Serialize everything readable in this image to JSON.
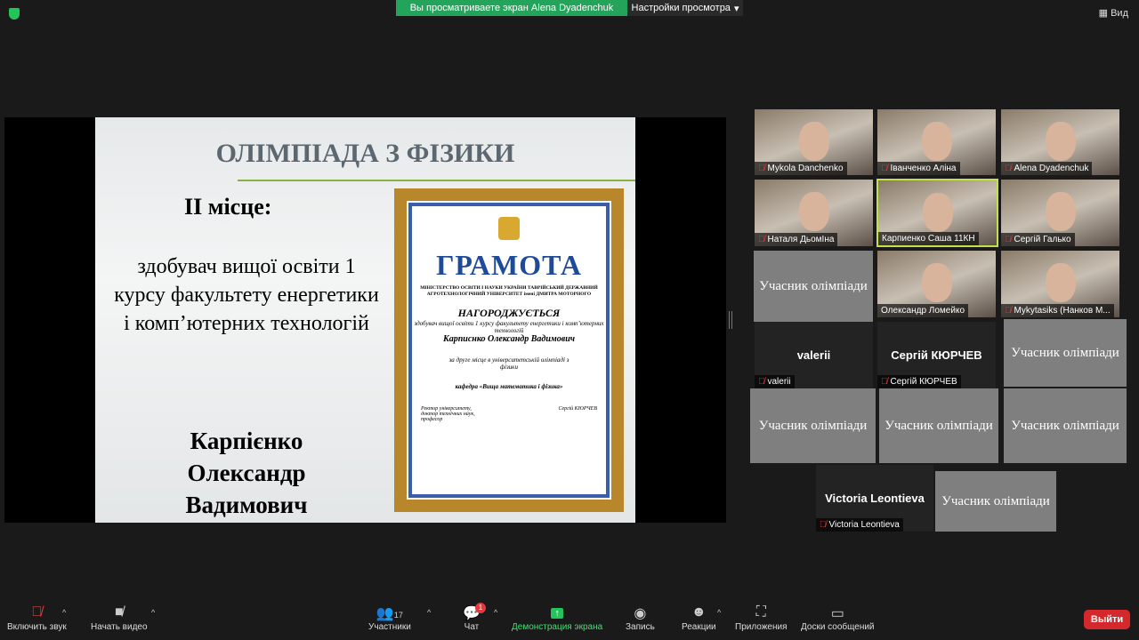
{
  "top": {
    "banner": "Вы просматриваете экран Alena Dyadenchuk",
    "view_options": "Настройки просмотра",
    "view": "Вид"
  },
  "slide": {
    "title": "ОЛІМПІАДА З ФІЗИКИ",
    "place": "ІІ місце:",
    "description": "здобувач вищої освіти 1 курсу факультету енергетики і комп’ютерних технологій",
    "winner": "Карпієнко Олександр Вадимович",
    "certificate": {
      "heading": "ГРАМОТА",
      "org": "МІНІСТЕРСТВО ОСВІТИ І НАУКИ УКРАЇНИ ТАВРІЙСЬКИЙ ДЕРЖАВНИЙ АГРОТЕХНОЛОГІЧНИЙ УНІВЕРСИТЕТ імені ДМИТРА МОТОРНОГО",
      "awarded": "НАГОРОДЖУЄТЬСЯ",
      "recipient_desc": "здобувач вищої освіти 1 курсу факультету енергетики і комп’ютерних технологій",
      "recipient": "Карписнко Олександр Вадимович",
      "reason": "за друге місце в університетській олімпіаді з фізики",
      "dept": "кафедра «Вища математика і фізика»",
      "signer_title": "Ректор університету, доктор технічних наук, професор",
      "signer": "Сергій КЮРЧЕВ"
    }
  },
  "participants": [
    {
      "name": "Mykola Danchenko",
      "type": "video",
      "muted": true
    },
    {
      "name": "Іванченко Аліна",
      "type": "video",
      "muted": true
    },
    {
      "name": "Alena Dyadenchuk",
      "type": "video",
      "muted": true
    },
    {
      "name": "Наталя ДьомІна",
      "type": "video",
      "muted": true
    },
    {
      "name": "Карпиенко Саша 11КН",
      "type": "video",
      "muted": false,
      "active": true
    },
    {
      "name": "Сергій Галько",
      "type": "video",
      "muted": true
    },
    {
      "name": "Учасник олімпіади",
      "type": "gray"
    },
    {
      "name": "Олександр Ломейко",
      "type": "video",
      "muted": false
    },
    {
      "name": "Mykytasiks (Нанков М...",
      "type": "video",
      "muted": true
    },
    {
      "name": "valerii",
      "type": "dark",
      "muted": true
    },
    {
      "name": "Сергій КЮРЧЕВ",
      "type": "dark",
      "muted": true
    },
    {
      "name": "Учасник олімпіади",
      "type": "gray"
    },
    {
      "name": "Учасник олімпіади",
      "type": "gray"
    },
    {
      "name": "Учасник олімпіади",
      "type": "gray"
    },
    {
      "name": "Учасник олімпіади",
      "type": "gray"
    },
    {
      "name": "Victoria Leontieva",
      "type": "dark",
      "muted": true
    },
    {
      "name": "Учасник олімпіади",
      "type": "gray"
    }
  ],
  "toolbar": {
    "unmute": "Включить звук",
    "video": "Начать видео",
    "participants": "Участники",
    "participants_count": "17",
    "chat": "Чат",
    "chat_badge": "1",
    "share": "Демонстрация экрана",
    "record": "Запись",
    "reactions": "Реакции",
    "apps": "Приложения",
    "whiteboards": "Доски сообщений",
    "leave": "Выйти"
  }
}
